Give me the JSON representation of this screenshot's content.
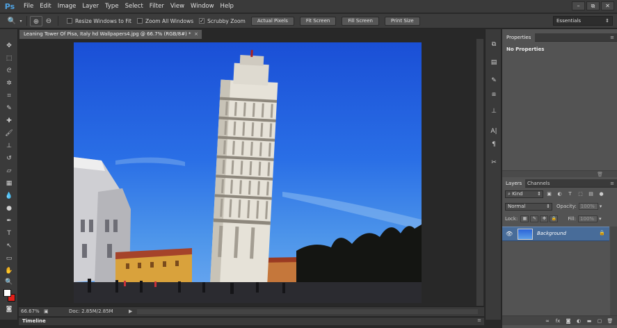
{
  "app": {
    "logo": "Ps"
  },
  "menu": [
    "File",
    "Edit",
    "Image",
    "Layer",
    "Type",
    "Select",
    "Filter",
    "View",
    "Window",
    "Help"
  ],
  "window_controls": {
    "minimize": "–",
    "restore": "⧉",
    "close": "✕"
  },
  "options_bar": {
    "tool_icon": "zoom-tool-icon",
    "resize_windows": {
      "label": "Resize Windows to Fit",
      "checked": false
    },
    "zoom_all_windows": {
      "label": "Zoom All Windows",
      "checked": false
    },
    "scrubby_zoom": {
      "label": "Scrubby Zoom",
      "checked": true
    },
    "buttons": [
      "Actual Pixels",
      "Fit Screen",
      "Fill Screen",
      "Print Size"
    ],
    "workspace": "Essentials"
  },
  "document": {
    "tab_title": "Leaning Tower Of Pisa, Italy hd Wallpapers4.jpg @ 66.7% (RGB/8#) *",
    "zoom": "66.67%",
    "doc_size": "Doc: 2.85M/2.85M"
  },
  "timeline": {
    "label": "Timeline"
  },
  "properties_panel": {
    "tab": "Properties",
    "body": "No Properties"
  },
  "layers_panel": {
    "tabs": [
      "Layers",
      "Channels"
    ],
    "filter_kind": "Kind",
    "blend_mode": "Normal",
    "opacity_label": "Opacity:",
    "opacity_value": "100%",
    "lock_label": "Lock:",
    "fill_label": "Fill:",
    "fill_value": "100%",
    "layers": [
      {
        "name": "Background",
        "visible": true,
        "locked": true
      }
    ]
  },
  "colors": {
    "foreground": "#ffffff",
    "background": "#e0201a",
    "accent": "#4fa3e3",
    "selected_layer": "#486c99"
  }
}
